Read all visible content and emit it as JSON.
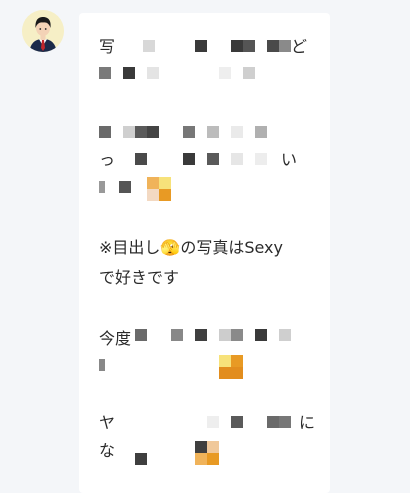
{
  "message": {
    "line_fragments": [
      {
        "text": "写",
        "hint": "mosaic"
      },
      {
        "text": "ど",
        "hint": "mosaic"
      }
    ],
    "visible_sentence_line1": "※目出し🫣の写真はSexy",
    "visible_sentence_line2": "で好きです",
    "fragment_imaplanned": "今度",
    "fragment_na": "な",
    "fragment_tsu": "っ",
    "fragment_i": "い",
    "fragment_ya": "ヤ",
    "fragment_ni": "に"
  },
  "avatar": {
    "bg": "#f6efc6",
    "hair": "#1a1a1a",
    "skin": "#f3d2b6",
    "suit": "#1b2a4a",
    "tie": "#c2262c"
  },
  "colors": {
    "mosaic_dark": "#3f3f3f",
    "mosaic_mid": "#8a8a8a",
    "mosaic_light": "#cfcfcf",
    "emoji_yellow": "#f7d34b",
    "emoji_orange": "#e89a24"
  }
}
